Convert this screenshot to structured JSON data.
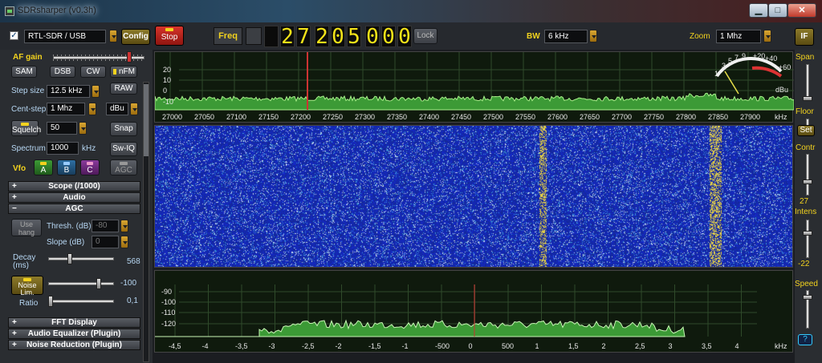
{
  "window": {
    "title": "SDRsharper (v0.3h)",
    "min": "▁",
    "max": "□",
    "close": "✕"
  },
  "toolbar": {
    "device": "RTL-SDR / USB",
    "config": "Config",
    "stop": "Stop",
    "freq_label": "Freq",
    "freq_digits": [
      "2",
      "7",
      "2",
      "0",
      "5",
      "0",
      "0",
      "0"
    ],
    "lock": "Lock",
    "bw_label": "BW",
    "bw_value": "6 kHz",
    "zoom_label": "Zoom",
    "zoom_value": "1 Mhz",
    "if": "IF"
  },
  "left": {
    "af_gain": "AF gain",
    "modes": [
      "SAM",
      "DSB",
      "CW",
      "nFM"
    ],
    "raw": "RAW",
    "step_size_label": "Step size",
    "step_size": "12.5 kHz",
    "cent_step_label": "Cent-step",
    "cent_step": "1 Mhz",
    "dbu": "dBu",
    "squelch": "Squelch",
    "squelch_value": "50",
    "snap": "Snap",
    "spectrum_label": "Spectrum",
    "spectrum_value": "1000",
    "khz": "kHz",
    "swiq": "Sw-IQ",
    "vfo": "Vfo",
    "vfo_a": "A",
    "vfo_b": "B",
    "vfo_c": "C",
    "agc": "AGC",
    "sections_top": [
      "Scope (/1000)",
      "Audio",
      "AGC"
    ],
    "use_hang": "Use hang",
    "thresh_label": "Thresh. (dB)",
    "thresh_value": "-80",
    "slope_label": "Slope (dB)",
    "slope_value": "0",
    "decay_label": "Decay (ms)",
    "decay_value": "568",
    "noise_lim": "Noise Lim.",
    "noise_value": "-100",
    "ratio_label": "Ratio",
    "ratio_value": "0,1",
    "sections_bottom": [
      "FFT Display",
      "Audio Equalizer (Plugin)",
      "Noise Reduction (Plugin)"
    ]
  },
  "spectrum": {
    "y_ticks": [
      "20",
      "10",
      "0",
      "-10"
    ],
    "x_ticks": [
      "27000",
      "27050",
      "27100",
      "27150",
      "27200",
      "27250",
      "27300",
      "27350",
      "27400",
      "27450",
      "27500",
      "27550",
      "27600",
      "27650",
      "27700",
      "27750",
      "27800",
      "27850",
      "27900"
    ],
    "x_unit": "kHz",
    "smeter_ticks": [
      "1",
      "3",
      "5",
      "7",
      "9",
      "+20",
      "+40",
      "+60"
    ],
    "smeter_label": "dBu"
  },
  "audio": {
    "y_ticks": [
      "-90",
      "-100",
      "-110",
      "-120"
    ],
    "x_ticks": [
      "-4,5",
      "-4",
      "-3,5",
      "-3",
      "-2,5",
      "-2",
      "-1,5",
      "-1",
      "-500",
      "0",
      "500",
      "1",
      "1,5",
      "2",
      "2,5",
      "3",
      "3,5",
      "4"
    ],
    "x_unit": "kHz"
  },
  "right": {
    "span": "Span",
    "floor": "Floor",
    "set": "Set",
    "contr": "Contr",
    "contr_value": "27",
    "intens": "Intens",
    "intens_value": "-22",
    "speed": "Speed",
    "help": "?"
  },
  "colors": {
    "accent": "#f2d21e",
    "trace": "#7fdc6a",
    "waterfall_bg": "#1a2ba0"
  }
}
